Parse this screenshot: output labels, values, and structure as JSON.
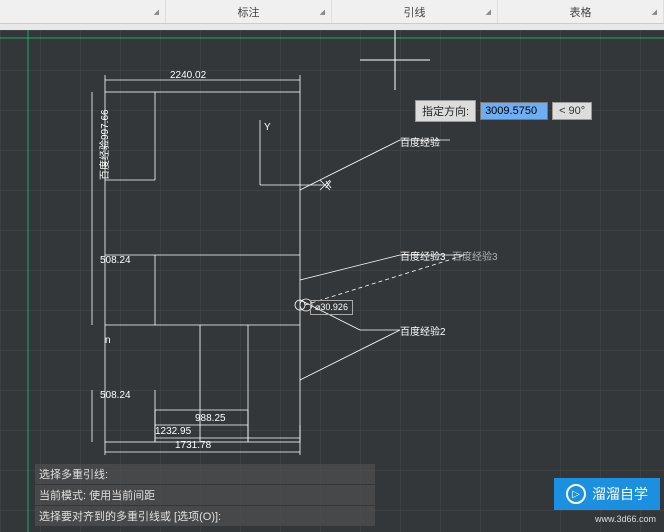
{
  "ribbon": {
    "tabs": [
      "",
      "标注",
      "引线",
      "表格"
    ]
  },
  "input": {
    "label": "指定方向:",
    "value": "3009.5750",
    "angle": "< 90°"
  },
  "dims": {
    "top": "2240.02",
    "left_height": "百度经验997.66",
    "mid_left1": "508.24",
    "mid_left2": "508.24",
    "bottom1": "988.25",
    "bottom2": "1232.95",
    "bottom3": "1731.78",
    "n": "n"
  },
  "leaders": {
    "l1": "百度经验",
    "l2": "百度经验2",
    "l3a": "百度经验3",
    "l3b": "百度经验3"
  },
  "diameter": "⌀30.926",
  "axis": {
    "x": "X",
    "y": "Y"
  },
  "cmd": {
    "line1": "选择多重引线:",
    "line2": "当前模式: 使用当前间距",
    "line3": "选择要对齐到的多重引线或 [选项(O)]:"
  },
  "brand": {
    "name": "溜溜自学",
    "url": "www.3d66.com"
  }
}
